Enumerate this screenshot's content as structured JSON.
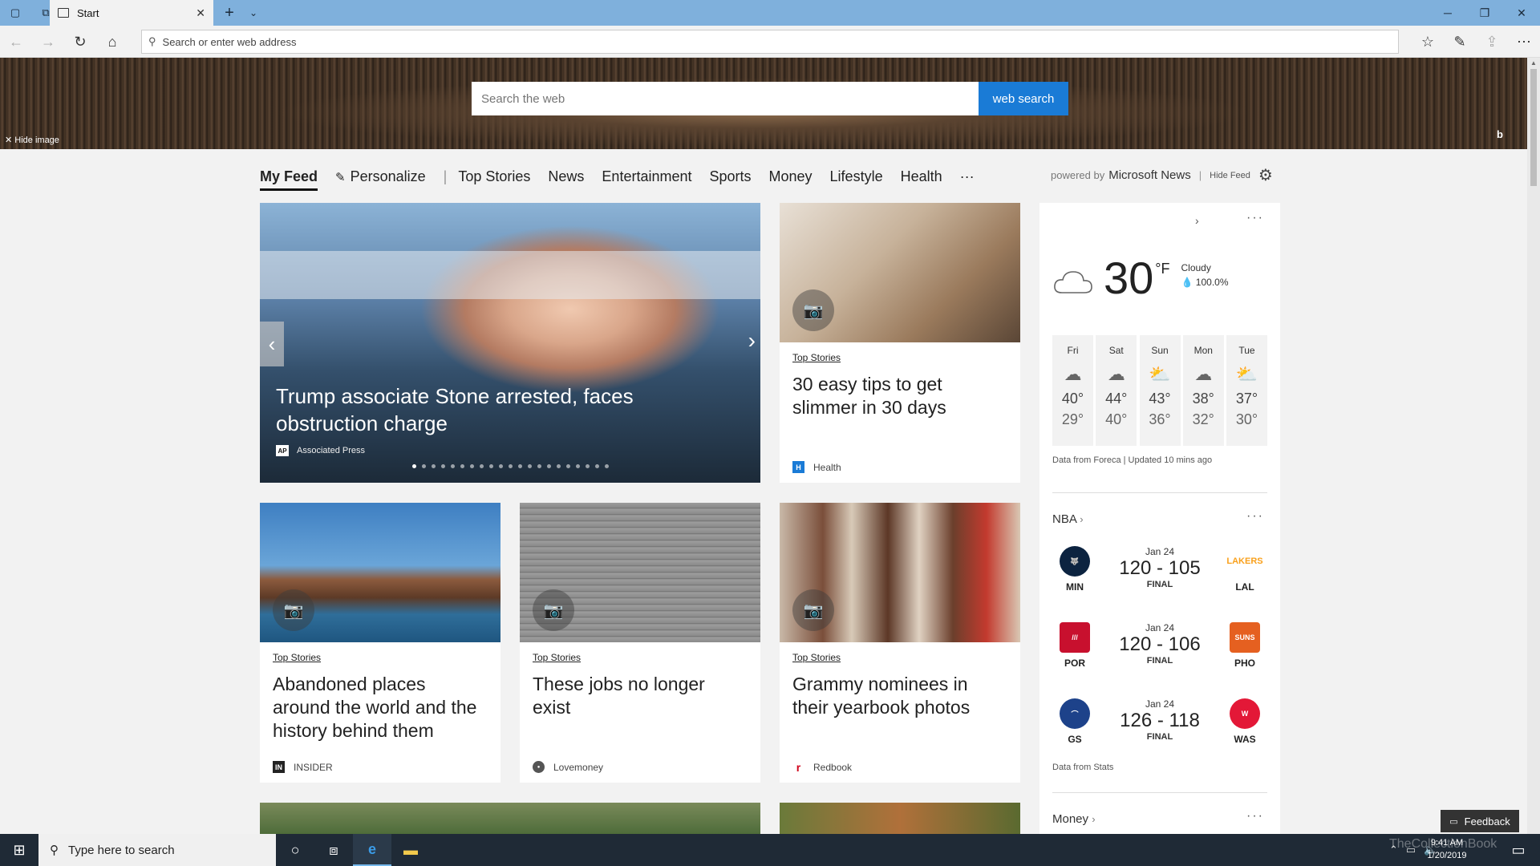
{
  "browser": {
    "tab_title": "Start",
    "address_placeholder": "Search or enter web address"
  },
  "hero": {
    "search_placeholder": "Search the web",
    "search_button": "web search",
    "hide_image": "Hide image"
  },
  "feed_nav": {
    "active": "My Feed",
    "personalize": "Personalize",
    "items": [
      "Top Stories",
      "News",
      "Entertainment",
      "Sports",
      "Money",
      "Lifestyle",
      "Health"
    ],
    "more": "···",
    "powered_prefix": "powered by",
    "powered_brand": "Microsoft News",
    "hide_feed": "Hide Feed"
  },
  "carousel": {
    "headline": "Trump associate Stone arrested, faces obstruction charge",
    "source": "Associated Press",
    "source_logo": "AP",
    "slide_count": 21,
    "active_slide": 1
  },
  "cards": [
    {
      "category": "Top Stories",
      "headline": "30 easy tips to get slimmer in 30 days",
      "source": "Health",
      "logo": "H",
      "logo_color": "#1a7bd6"
    },
    {
      "category": "Top Stories",
      "headline": "Abandoned places around the world and the history behind them",
      "source": "INSIDER",
      "logo": "IN",
      "logo_color": "#222222"
    },
    {
      "category": "Top Stories",
      "headline": "These jobs no longer exist",
      "source": "Lovemoney",
      "logo": "●",
      "logo_color": "#555555"
    },
    {
      "category": "Top Stories",
      "headline": "Grammy nominees in their yearbook photos",
      "source": "Redbook",
      "logo": "r",
      "logo_color": "#d0021b"
    }
  ],
  "weather": {
    "temp": "30",
    "unit": "°F",
    "condition": "Cloudy",
    "precip": "100.0%",
    "forecast": [
      {
        "day": "Fri",
        "hi": "40°",
        "lo": "29°"
      },
      {
        "day": "Sat",
        "hi": "44°",
        "lo": "40°"
      },
      {
        "day": "Sun",
        "hi": "43°",
        "lo": "36°"
      },
      {
        "day": "Mon",
        "hi": "38°",
        "lo": "32°"
      },
      {
        "day": "Tue",
        "hi": "37°",
        "lo": "30°"
      }
    ],
    "note": "Data from Foreca | Updated 10 mins ago"
  },
  "nba": {
    "title": "NBA",
    "games": [
      {
        "date": "Jan 24",
        "score": "120 - 105",
        "status": "FINAL",
        "home": "MIN",
        "away": "LAL",
        "home_color": "#0c2340",
        "away_color": "#552583"
      },
      {
        "date": "Jan 24",
        "score": "120 - 106",
        "status": "FINAL",
        "home": "POR",
        "away": "PHO",
        "home_color": "#c8102e",
        "away_color": "#e56020"
      },
      {
        "date": "Jan 24",
        "score": "126 - 118",
        "status": "FINAL",
        "home": "GS",
        "away": "WAS",
        "home_color": "#1d428a",
        "away_color": "#e31837"
      }
    ],
    "note": "Data from Stats"
  },
  "money": {
    "title": "Money"
  },
  "feedback": "Feedback",
  "taskbar": {
    "search_placeholder": "Type here to search",
    "time": "9:41 AM",
    "date": "1/20/2019"
  },
  "watermark": "TheCollectionBook",
  "colors": {
    "accent": "#1a7bd6",
    "titlebar": "#7fb0dc",
    "taskbar": "#1f2a36"
  }
}
